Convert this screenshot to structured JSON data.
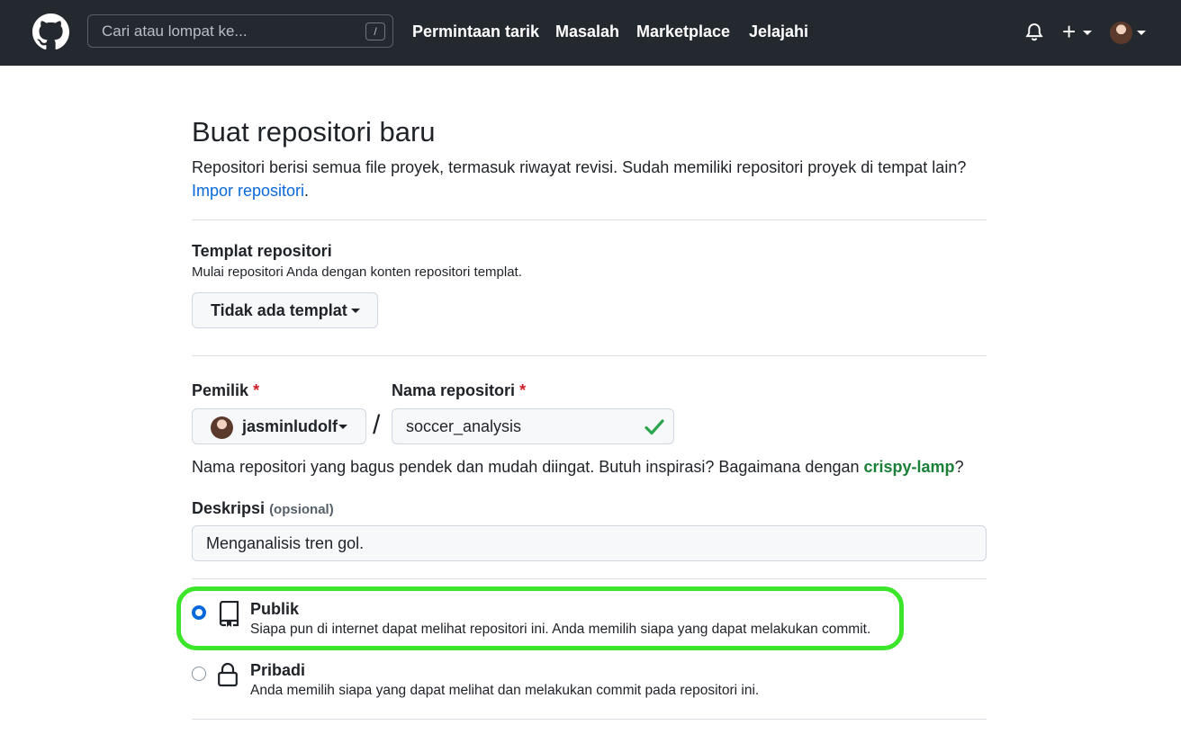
{
  "header": {
    "search_placeholder": "Cari atau lompat ke...",
    "search_shortcut": "/",
    "nav": [
      "Permintaan tarik",
      "Masalah",
      "Marketplace",
      "Jelajahi"
    ],
    "plus_label": "+"
  },
  "page": {
    "title": "Buat repositori baru",
    "intro": "Repositori berisi semua file proyek, termasuk riwayat revisi. Sudah memiliki repositori proyek di tempat lain?",
    "import_link": "Impor repositori",
    "import_suffix": "."
  },
  "template": {
    "title": "Templat repositori",
    "subtitle": "Mulai repositori Anda dengan konten repositori templat.",
    "button": "Tidak ada templat"
  },
  "owner": {
    "label": "Pemilik",
    "required": "*",
    "value": "jasminludolf"
  },
  "separator": "/",
  "repo": {
    "label": "Nama repositori",
    "required": "*",
    "value": "soccer_analysis"
  },
  "hint": {
    "text": "Nama repositori yang bagus pendek dan mudah diingat. Butuh inspirasi? Bagaimana dengan",
    "suggestion": "crispy-lamp",
    "suffix": "?"
  },
  "description": {
    "label": "Deskripsi",
    "optional": "(opsional)",
    "value": "Menganalisis tren gol."
  },
  "visibility": [
    {
      "title": "Publik",
      "desc": "Siapa pun di internet dapat melihat repositori ini. Anda memilih siapa yang dapat melakukan commit.",
      "selected": true
    },
    {
      "title": "Pribadi",
      "desc": "Anda memilih siapa yang dapat melihat dan melakukan commit pada repositori ini.",
      "selected": false
    }
  ],
  "colors": {
    "header_bg": "#24292f",
    "link": "#0a69da",
    "suggestion": "#1a7f37",
    "required": "#cf222e",
    "highlight": "#3be62a",
    "radio_selected": "#0969da"
  }
}
